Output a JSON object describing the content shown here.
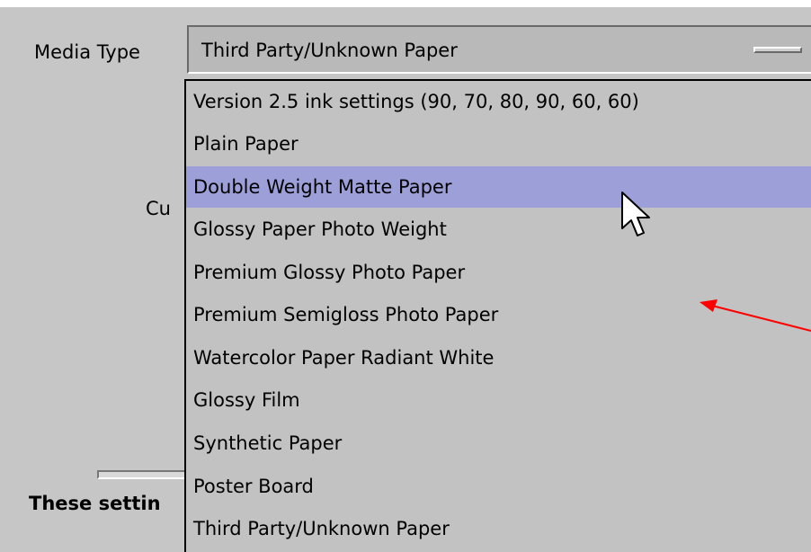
{
  "media_type": {
    "label": "Media Type",
    "selected_value": "Third Party/Unknown Paper",
    "highlighted_option": "Double Weight Matte Paper",
    "options": [
      "Version 2.5 ink settings (90, 70, 80, 90, 60, 60)",
      "Plain Paper",
      "Double Weight Matte Paper",
      "Glossy Paper Photo Weight",
      "Premium Glossy Photo Paper",
      "Premium Semigloss Photo Paper",
      "Watercolor Paper Radiant White",
      "Glossy Film",
      "Synthetic Paper",
      "Poster Board",
      "Third Party/Unknown Paper"
    ]
  },
  "background_labels": {
    "cut_off": "Cu",
    "these_settings": "These settin"
  },
  "icons": {
    "cursor": "mouse-pointer-icon",
    "annotation": "red-arrow-annotation"
  },
  "colors": {
    "panel_bg": "#c6c6c6",
    "highlight_bg": "#9d9fd9",
    "annotation": "#ff0000"
  }
}
